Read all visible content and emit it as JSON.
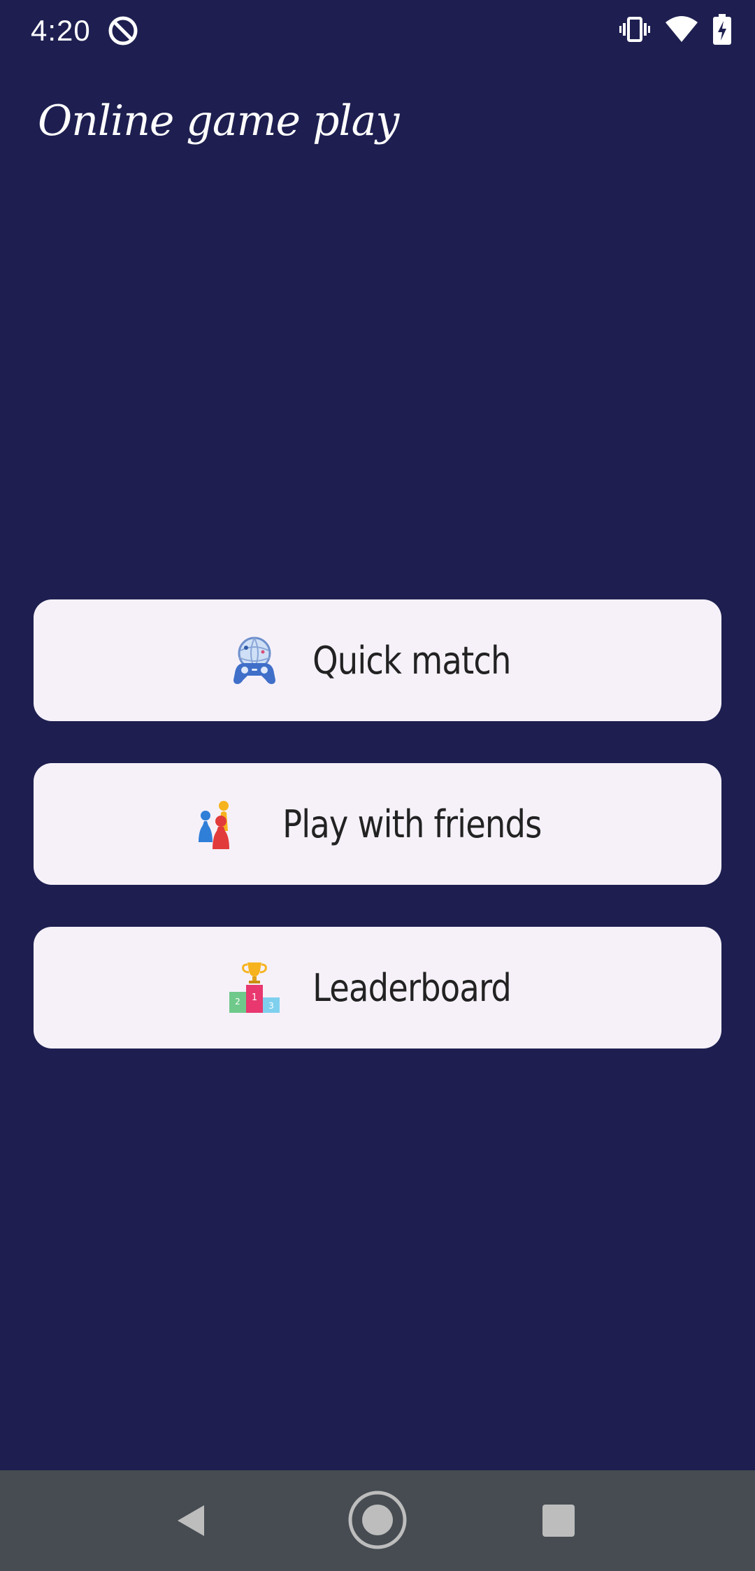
{
  "status_bar": {
    "time": "4:20",
    "icons": [
      "do-not-disturb-icon",
      "vibrate-icon",
      "wifi-icon",
      "battery-charging-icon"
    ]
  },
  "header": {
    "title": "Online game play"
  },
  "menu": {
    "items": [
      {
        "label": "Quick match",
        "icon": "gamepad-globe-icon"
      },
      {
        "label": "Play with friends",
        "icon": "game-pawns-icon"
      },
      {
        "label": "Leaderboard",
        "icon": "podium-trophy-icon"
      }
    ]
  },
  "nav_bar": {
    "buttons": [
      "back-icon",
      "home-icon",
      "recents-icon"
    ]
  },
  "colors": {
    "background": "#1e1f50",
    "button_bg": "#f6f1f9",
    "button_text": "#222222",
    "nav_bar": "#464c52"
  }
}
